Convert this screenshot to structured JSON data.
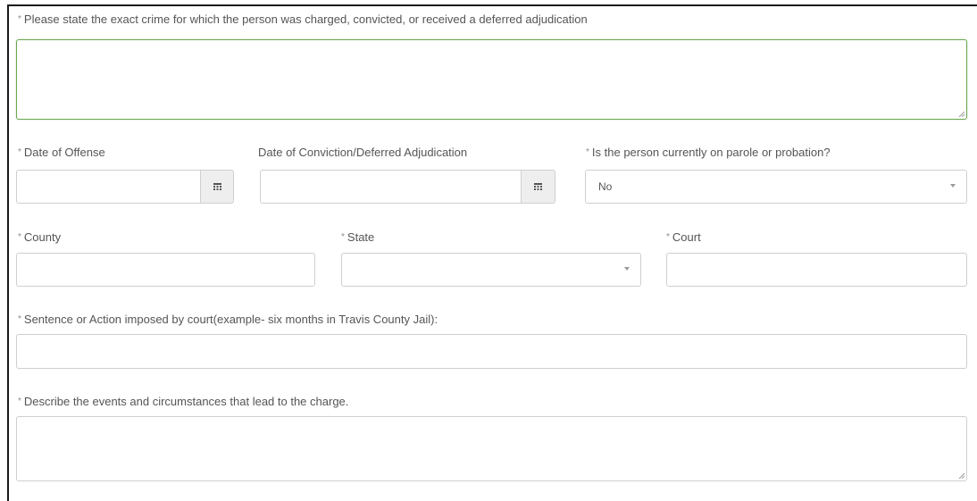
{
  "form": {
    "required_marker": "*",
    "crime": {
      "label": "Please state the exact crime for which the person was charged, convicted, or received a deferred adjudication",
      "value": ""
    },
    "date_of_offense": {
      "label": "Date of Offense",
      "value": "",
      "icon": "calendar-icon"
    },
    "date_of_conviction": {
      "label": "Date of Conviction/Deferred Adjudication",
      "value": "",
      "icon": "calendar-icon"
    },
    "parole": {
      "label": "Is the person currently on parole or probation?",
      "selected": "No"
    },
    "county": {
      "label": "County",
      "value": ""
    },
    "state": {
      "label": "State",
      "selected": ""
    },
    "court": {
      "label": "Court",
      "value": ""
    },
    "sentence": {
      "label": "Sentence or Action imposed by court(example- six months in Travis County Jail):",
      "value": ""
    },
    "events": {
      "label": "Describe the events and circumstances that lead to the charge.",
      "value": ""
    }
  },
  "colors": {
    "focus_border": "#6aa84f",
    "border": "#cfcfcf",
    "label": "#555555"
  }
}
